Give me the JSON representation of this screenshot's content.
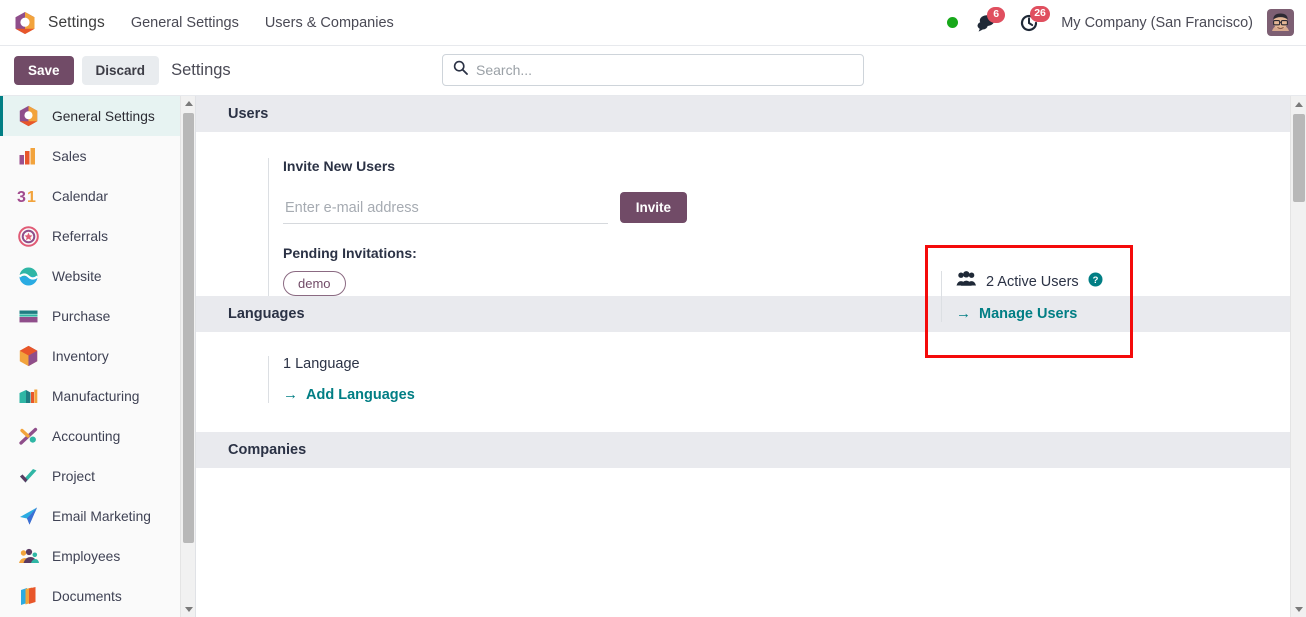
{
  "navbar": {
    "logo_icon": "odoo-hexagon-logo",
    "brand": "Settings",
    "links": [
      {
        "label": "General Settings",
        "name": "nav-general-settings"
      },
      {
        "label": "Users & Companies",
        "name": "nav-users-companies"
      }
    ],
    "status_indicator": "online-status-dot",
    "messages": {
      "icon": "chat-bubble-icon",
      "count": "6"
    },
    "activities": {
      "icon": "clock-activity-icon",
      "count": "26"
    },
    "company": "My Company (San Francisco)",
    "avatar_icon": "user-avatar"
  },
  "control_panel": {
    "save_label": "Save",
    "discard_label": "Discard",
    "title": "Settings"
  },
  "search": {
    "icon": "search-icon",
    "placeholder": "Search...",
    "value": ""
  },
  "sidebar": {
    "items": [
      {
        "label": "General Settings",
        "icon": "settings-app-icon",
        "active": true
      },
      {
        "label": "Sales",
        "icon": "sales-app-icon",
        "active": false
      },
      {
        "label": "Calendar",
        "icon": "calendar-app-icon",
        "active": false
      },
      {
        "label": "Referrals",
        "icon": "referrals-app-icon",
        "active": false
      },
      {
        "label": "Website",
        "icon": "website-app-icon",
        "active": false
      },
      {
        "label": "Purchase",
        "icon": "purchase-app-icon",
        "active": false
      },
      {
        "label": "Inventory",
        "icon": "inventory-app-icon",
        "active": false
      },
      {
        "label": "Manufacturing",
        "icon": "manufacturing-app-icon",
        "active": false
      },
      {
        "label": "Accounting",
        "icon": "accounting-app-icon",
        "active": false
      },
      {
        "label": "Project",
        "icon": "project-app-icon",
        "active": false
      },
      {
        "label": "Email Marketing",
        "icon": "email-marketing-app-icon",
        "active": false
      },
      {
        "label": "Employees",
        "icon": "employees-app-icon",
        "active": false
      },
      {
        "label": "Documents",
        "icon": "documents-app-icon",
        "active": false
      }
    ]
  },
  "sections": {
    "users": {
      "header": "Users",
      "invite_title": "Invite New Users",
      "email_placeholder": "Enter e-mail address",
      "email_value": "",
      "invite_button": "Invite",
      "pending_label": "Pending Invitations:",
      "pending": [
        "demo"
      ],
      "active_users": "2 Active Users",
      "help_icon": "help-circle-icon",
      "manage_users_link": "Manage Users",
      "arrow_glyph": "→"
    },
    "languages": {
      "header": "Languages",
      "count": "1 Language",
      "add_link": "Add Languages",
      "arrow_glyph": "→"
    },
    "companies": {
      "header": "Companies"
    }
  },
  "colors": {
    "primary_purple": "#714b67",
    "accent_teal": "#017e84",
    "highlight_red": "#f40b0b",
    "badge_red": "#e04f5f",
    "status_green": "#17a81a",
    "section_header_bg": "#e9eaee"
  }
}
